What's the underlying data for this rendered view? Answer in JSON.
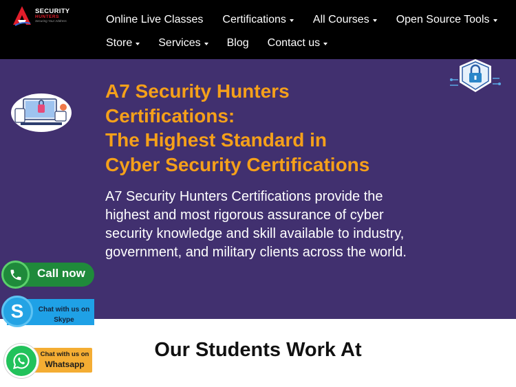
{
  "brand": {
    "name": "SECURITY",
    "sub": "HUNTERS",
    "tagline": "Securing Your Address"
  },
  "nav": {
    "row1": [
      {
        "label": "Online Live Classes",
        "dropdown": false
      },
      {
        "label": "Certifications",
        "dropdown": true
      },
      {
        "label": "All Courses",
        "dropdown": true
      },
      {
        "label": "Open Source Tools",
        "dropdown": true
      }
    ],
    "row2": [
      {
        "label": "Store",
        "dropdown": true
      },
      {
        "label": "Services",
        "dropdown": true
      },
      {
        "label": "Blog",
        "dropdown": false
      },
      {
        "label": "Contact us",
        "dropdown": true
      }
    ]
  },
  "hero": {
    "title_lines": [
      "A7 Security Hunters",
      "Certifications:",
      "The Highest Standard in",
      "Cyber Security Certifications"
    ],
    "description": "A7 Security Hunters Certifications provide the highest and most rigorous assurance of cyber security knowledge and skill available to industry, government, and military clients across the world."
  },
  "contact": {
    "call_label": "Call now",
    "skype_line1": "Chat with us on",
    "skype_line2": "Skype",
    "whatsapp_line1": "Chat with us on",
    "whatsapp_line2": "Whatsapp"
  },
  "students": {
    "heading": "Our Students Work At"
  },
  "colors": {
    "nav_bg": "#000000",
    "hero_bg": "#41306f",
    "hero_title": "#f5a01a",
    "call_green": "#1f8a3b",
    "skype_blue": "#1fa1e6",
    "whatsapp_green": "#22c25b",
    "whatsapp_box": "#f4ad33"
  }
}
